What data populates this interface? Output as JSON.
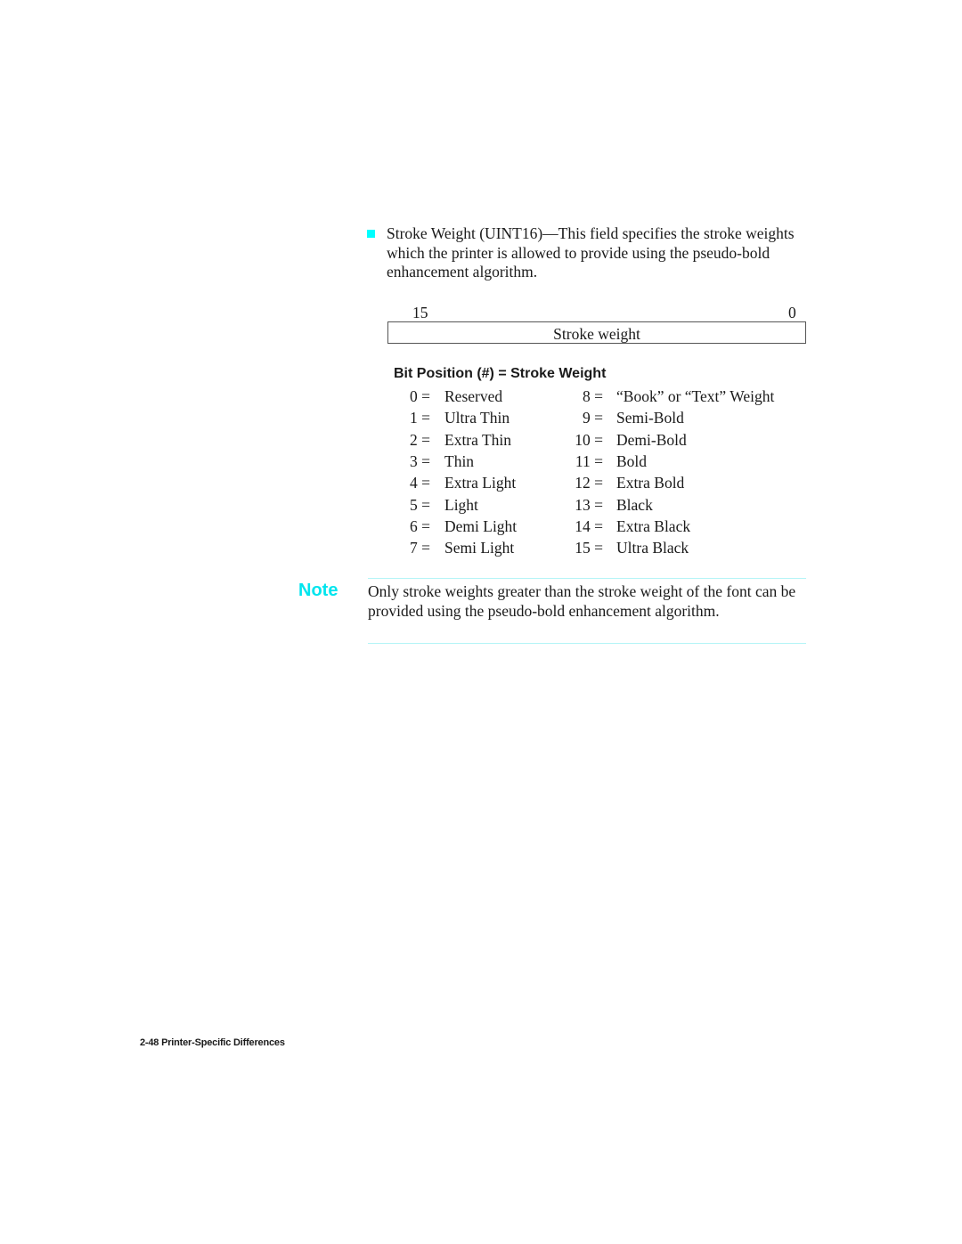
{
  "intro": {
    "bullet_icon": "square-bullet",
    "text": "Stroke Weight (UINT16)—This field specifies the stroke weights which the printer is allowed to provide using the pseudo-bold enhancement algorithm."
  },
  "bit_diagram": {
    "high_bit": "15",
    "low_bit": "0",
    "field_label": "Stroke weight"
  },
  "table": {
    "title": "Bit Position (#) = Stroke Weight",
    "left": [
      {
        "num": "0 =",
        "label": "Reserved"
      },
      {
        "num": "1 =",
        "label": "Ultra Thin"
      },
      {
        "num": "2 =",
        "label": "Extra Thin"
      },
      {
        "num": "3 =",
        "label": "Thin"
      },
      {
        "num": "4 =",
        "label": "Extra Light"
      },
      {
        "num": "5 =",
        "label": "Light"
      },
      {
        "num": "6 =",
        "label": "Demi Light"
      },
      {
        "num": "7 =",
        "label": "Semi Light"
      }
    ],
    "right": [
      {
        "num": "8 =",
        "label": "“Book”  or “Text” Weight"
      },
      {
        "num": "9 =",
        "label": "Semi-Bold"
      },
      {
        "num": "10 =",
        "label": "Demi-Bold"
      },
      {
        "num": "11 =",
        "label": "Bold"
      },
      {
        "num": "12 =",
        "label": "Extra Bold"
      },
      {
        "num": "13 =",
        "label": "Black"
      },
      {
        "num": "14 =",
        "label": "Extra Black"
      },
      {
        "num": "15 =",
        "label": "Ultra Black"
      }
    ]
  },
  "note": {
    "label": "Note",
    "text": "Only stroke weights greater than the stroke weight of the font can be provided using the pseudo-bold enhancement algorithm.",
    "accent_color": "#00e5ee"
  },
  "footer": {
    "text": "2-48  Printer-Specific Differences"
  }
}
